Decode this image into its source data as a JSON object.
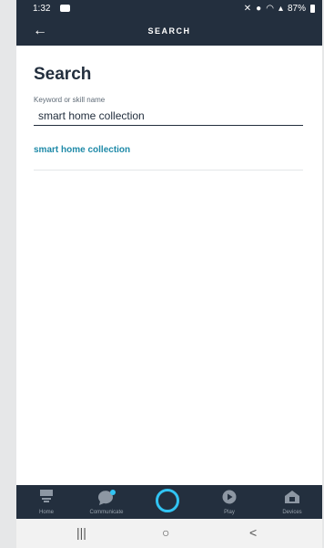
{
  "status_bar": {
    "time": "1:32",
    "battery": "87%"
  },
  "header": {
    "title": "SEARCH"
  },
  "main": {
    "title": "Search",
    "search": {
      "label": "Keyword or skill name",
      "value": "smart home collection"
    },
    "results": [
      {
        "label": "smart home collection"
      }
    ]
  },
  "bottom_nav": {
    "items": [
      {
        "label": "Home",
        "icon": "home-icon"
      },
      {
        "label": "Communicate",
        "icon": "chat-icon"
      },
      {
        "label": "",
        "icon": "alexa-ring-icon"
      },
      {
        "label": "Play",
        "icon": "play-icon"
      },
      {
        "label": "Devices",
        "icon": "devices-icon"
      }
    ]
  },
  "system_nav": {
    "recents_glyph": "|||",
    "home_glyph": "○",
    "back_glyph": "<"
  },
  "colors": {
    "header_bg": "#232f3e",
    "accent": "#1f8aa8",
    "alexa": "#31c4f3"
  }
}
